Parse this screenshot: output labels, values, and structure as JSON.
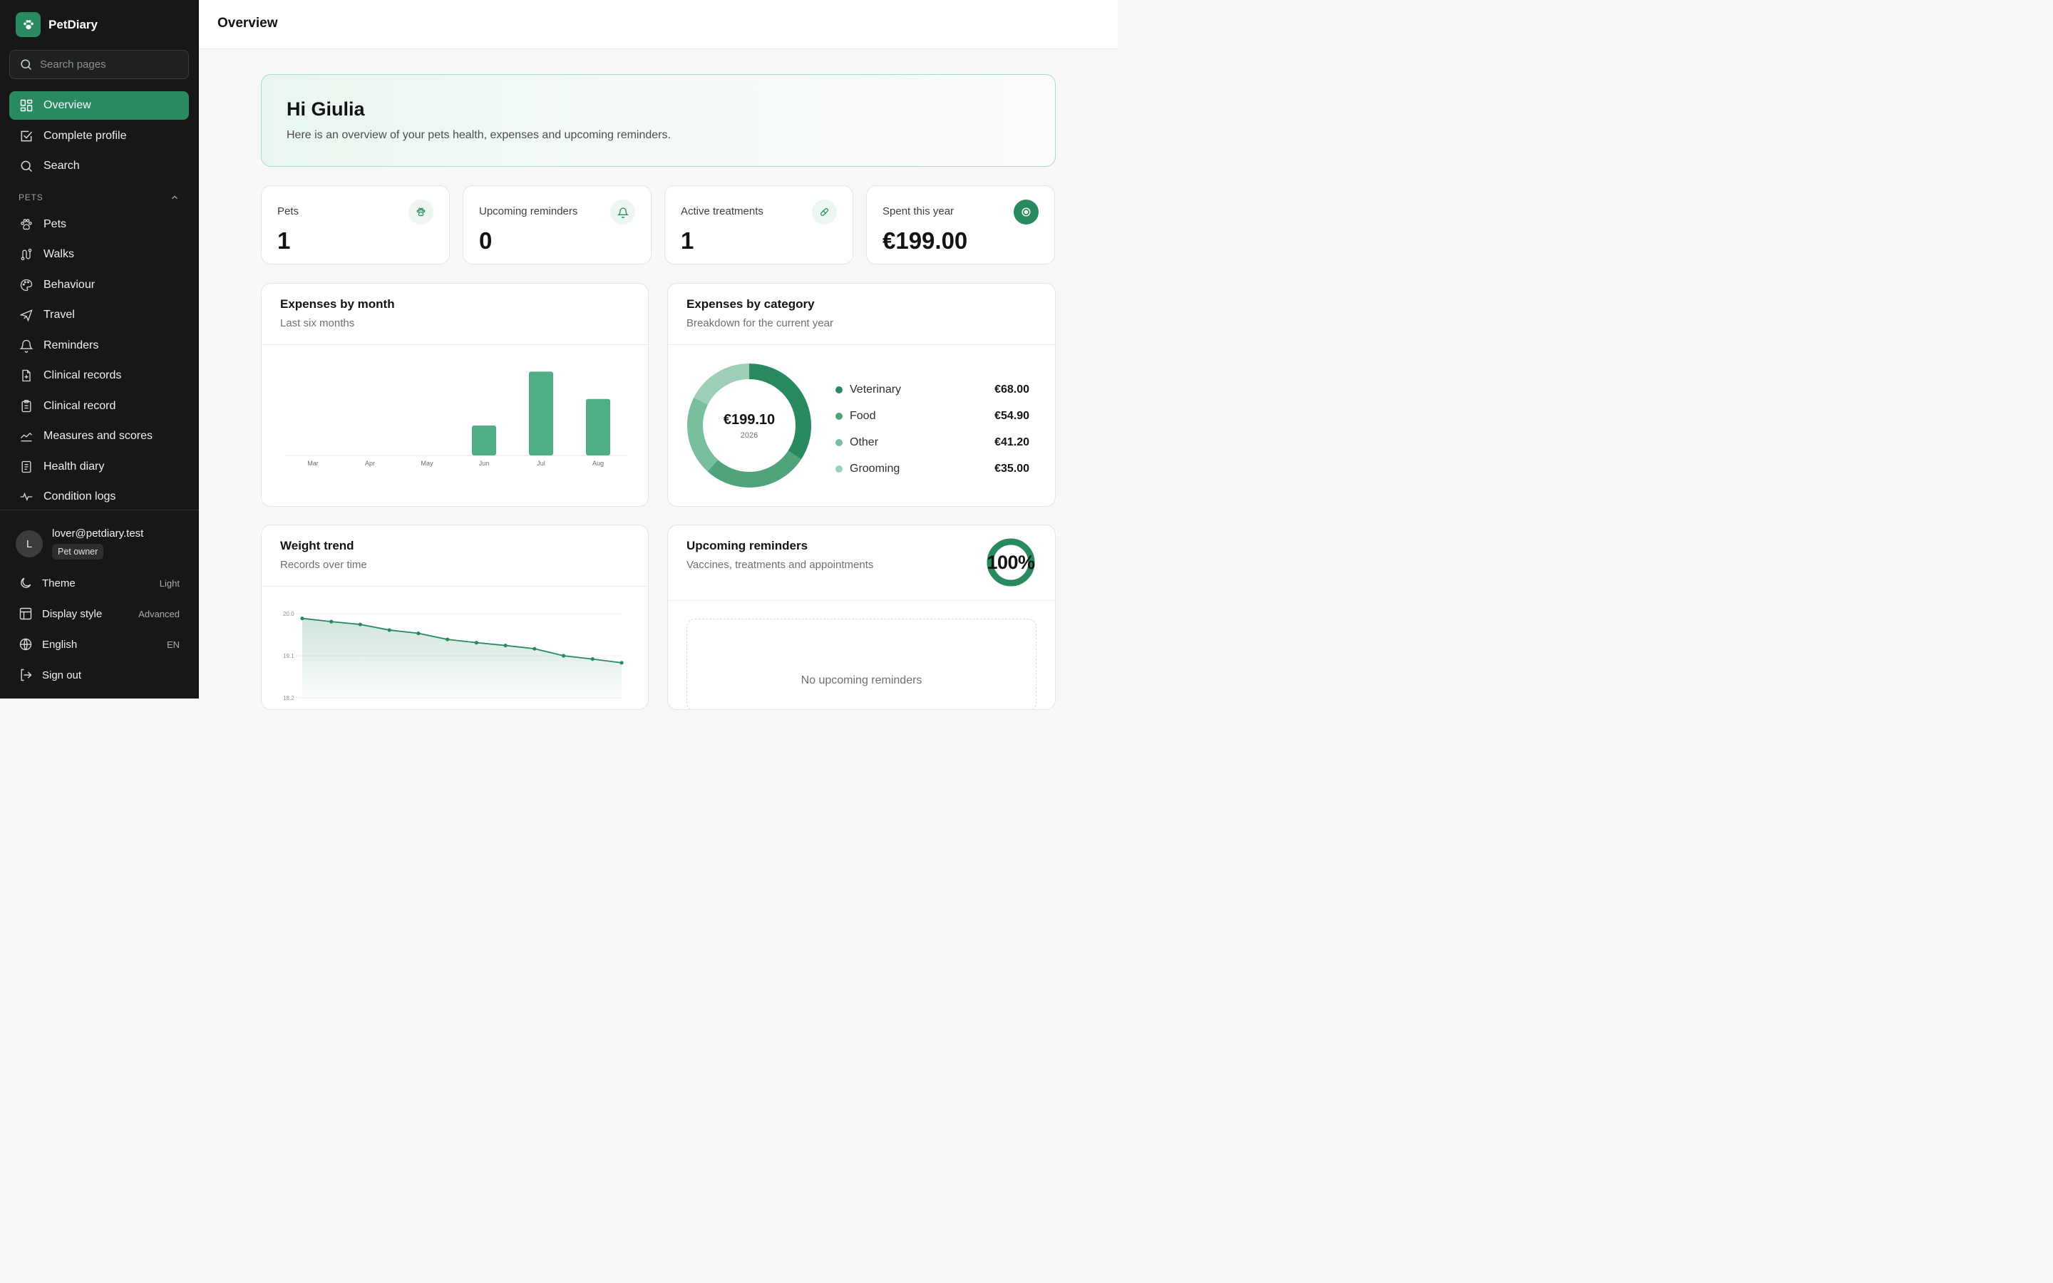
{
  "app": {
    "name": "PetDiary"
  },
  "search": {
    "placeholder": "Search pages"
  },
  "nav": {
    "primary": [
      {
        "label": "Overview",
        "icon": "grid-icon",
        "active": true
      },
      {
        "label": "Complete profile",
        "icon": "check-square-icon"
      },
      {
        "label": "Search",
        "icon": "search-icon"
      }
    ],
    "section_label": "PETS",
    "pets": [
      {
        "label": "Pets",
        "icon": "paw-icon"
      },
      {
        "label": "Walks",
        "icon": "route-icon"
      },
      {
        "label": "Behaviour",
        "icon": "palette-icon"
      },
      {
        "label": "Travel",
        "icon": "plane-icon"
      },
      {
        "label": "Reminders",
        "icon": "bell-icon"
      },
      {
        "label": "Clinical records",
        "icon": "file-plus-icon"
      },
      {
        "label": "Clinical record",
        "icon": "clipboard-icon"
      },
      {
        "label": "Measures and scores",
        "icon": "chart-line-icon"
      },
      {
        "label": "Health diary",
        "icon": "notebook-icon"
      },
      {
        "label": "Condition logs",
        "icon": "activity-icon"
      }
    ]
  },
  "user": {
    "initial": "L",
    "email": "lover@petdiary.test",
    "role": "Pet owner"
  },
  "settings": [
    {
      "label": "Theme",
      "value": "Light",
      "icon": "moon-icon"
    },
    {
      "label": "Display style",
      "value": "Advanced",
      "icon": "layout-icon"
    },
    {
      "label": "English",
      "value": "EN",
      "icon": "globe-icon"
    },
    {
      "label": "Sign out",
      "value": "",
      "icon": "logout-icon"
    }
  ],
  "page": {
    "title": "Overview"
  },
  "hero": {
    "greeting": "Hi Giulia",
    "subtitle": "Here is an overview of your pets health, expenses and upcoming reminders."
  },
  "stats": [
    {
      "label": "Pets",
      "value": "1",
      "icon": "paw-icon"
    },
    {
      "label": "Upcoming reminders",
      "value": "0",
      "icon": "bell-icon"
    },
    {
      "label": "Active treatments",
      "value": "1",
      "icon": "pill-icon"
    },
    {
      "label": "Spent this year",
      "value": "€199.00",
      "icon": "target-icon"
    }
  ],
  "colors": {
    "accent": "#2a8a5f",
    "bar": "#4fae84"
  },
  "panels": {
    "expenses_month": {
      "title": "Expenses by month",
      "subtitle": "Last six months"
    },
    "expenses_category": {
      "title": "Expenses by category",
      "subtitle": "Breakdown for the current year",
      "center_value": "€199.10",
      "center_year": "2026",
      "items": [
        {
          "label": "Veterinary",
          "value": "€68.00",
          "color": "#2a8a5f"
        },
        {
          "label": "Food",
          "value": "€54.90",
          "color": "#4fa47c"
        },
        {
          "label": "Other",
          "value": "€41.20",
          "color": "#79bf9d"
        },
        {
          "label": "Grooming",
          "value": "€35.00",
          "color": "#9ccfb6"
        }
      ]
    },
    "weight": {
      "title": "Weight trend",
      "subtitle": "Records over time"
    },
    "reminders": {
      "title": "Upcoming reminders",
      "subtitle": "Vaccines, treatments and appointments",
      "progress_label": "100%",
      "progress": 1.0,
      "empty_text": "No upcoming reminders"
    }
  },
  "chart_data": [
    {
      "type": "bar",
      "categories": [
        "Mar",
        "Apr",
        "May",
        "Jun",
        "Jul",
        "Aug"
      ],
      "values": [
        0,
        0,
        0,
        35.0,
        98.0,
        66.0
      ],
      "ylim": [
        0,
        100
      ]
    },
    {
      "type": "pie",
      "categories": [
        "Veterinary",
        "Food",
        "Other",
        "Grooming"
      ],
      "values": [
        68.0,
        54.9,
        41.2,
        35.0
      ]
    },
    {
      "type": "line",
      "x": [
        1,
        2,
        3,
        4,
        5,
        6,
        7,
        8,
        9,
        10,
        11,
        12
      ],
      "values": [
        19.9,
        19.83,
        19.77,
        19.65,
        19.58,
        19.45,
        19.38,
        19.32,
        19.25,
        19.1,
        19.03,
        18.95
      ],
      "y_ticks": [
        "20.0",
        "19.1",
        "18.2"
      ],
      "ylim": [
        18.2,
        20.0
      ]
    }
  ]
}
